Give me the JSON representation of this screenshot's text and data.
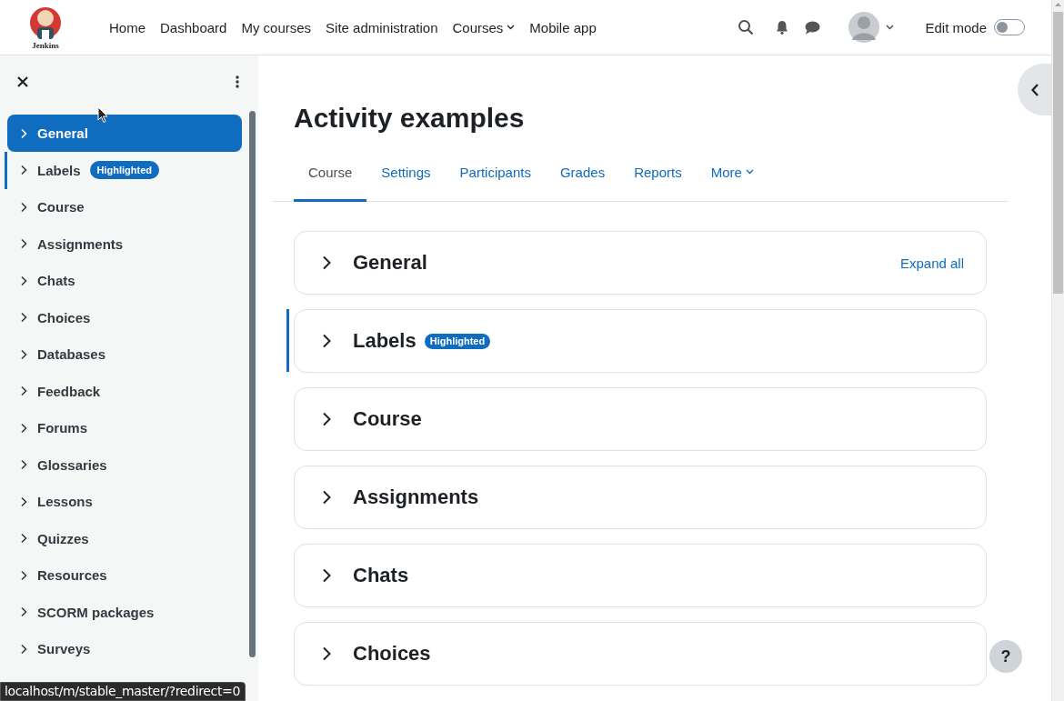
{
  "header": {
    "logo_text": "Jenkins",
    "nav": [
      {
        "label": "Home",
        "dropdown": false
      },
      {
        "label": "Dashboard",
        "dropdown": false
      },
      {
        "label": "My courses",
        "dropdown": false
      },
      {
        "label": "Site administration",
        "dropdown": false
      },
      {
        "label": "Courses",
        "dropdown": true
      },
      {
        "label": "Mobile app",
        "dropdown": false
      }
    ],
    "edit_mode": {
      "label": "Edit mode",
      "on": false
    }
  },
  "course_index": {
    "items": [
      {
        "label": "General",
        "selected": true,
        "highlighted": false
      },
      {
        "label": "Labels",
        "selected": false,
        "highlighted": true,
        "badge": "Highlighted"
      },
      {
        "label": "Course",
        "selected": false,
        "highlighted": false
      },
      {
        "label": "Assignments",
        "selected": false,
        "highlighted": false
      },
      {
        "label": "Chats",
        "selected": false,
        "highlighted": false
      },
      {
        "label": "Choices",
        "selected": false,
        "highlighted": false
      },
      {
        "label": "Databases",
        "selected": false,
        "highlighted": false
      },
      {
        "label": "Feedback",
        "selected": false,
        "highlighted": false
      },
      {
        "label": "Forums",
        "selected": false,
        "highlighted": false
      },
      {
        "label": "Glossaries",
        "selected": false,
        "highlighted": false
      },
      {
        "label": "Lessons",
        "selected": false,
        "highlighted": false
      },
      {
        "label": "Quizzes",
        "selected": false,
        "highlighted": false
      },
      {
        "label": "Resources",
        "selected": false,
        "highlighted": false
      },
      {
        "label": "SCORM packages",
        "selected": false,
        "highlighted": false
      },
      {
        "label": "Surveys",
        "selected": false,
        "highlighted": false
      }
    ]
  },
  "page_title": "Activity examples",
  "tabs": [
    {
      "label": "Course",
      "selected": true,
      "dropdown": false
    },
    {
      "label": "Settings",
      "selected": false,
      "dropdown": false
    },
    {
      "label": "Participants",
      "selected": false,
      "dropdown": false
    },
    {
      "label": "Grades",
      "selected": false,
      "dropdown": false
    },
    {
      "label": "Reports",
      "selected": false,
      "dropdown": false
    },
    {
      "label": "More",
      "selected": false,
      "dropdown": true
    }
  ],
  "expand_all": "Expand all",
  "sections": [
    {
      "title": "General",
      "highlighted": false
    },
    {
      "title": "Labels",
      "highlighted": true,
      "badge": "Highlighted"
    },
    {
      "title": "Course",
      "highlighted": false
    },
    {
      "title": "Assignments",
      "highlighted": false
    },
    {
      "title": "Chats",
      "highlighted": false
    },
    {
      "title": "Choices",
      "highlighted": false
    }
  ],
  "help_button": "?",
  "status_bar": "localhost/m/stable_master/?redirect=0"
}
